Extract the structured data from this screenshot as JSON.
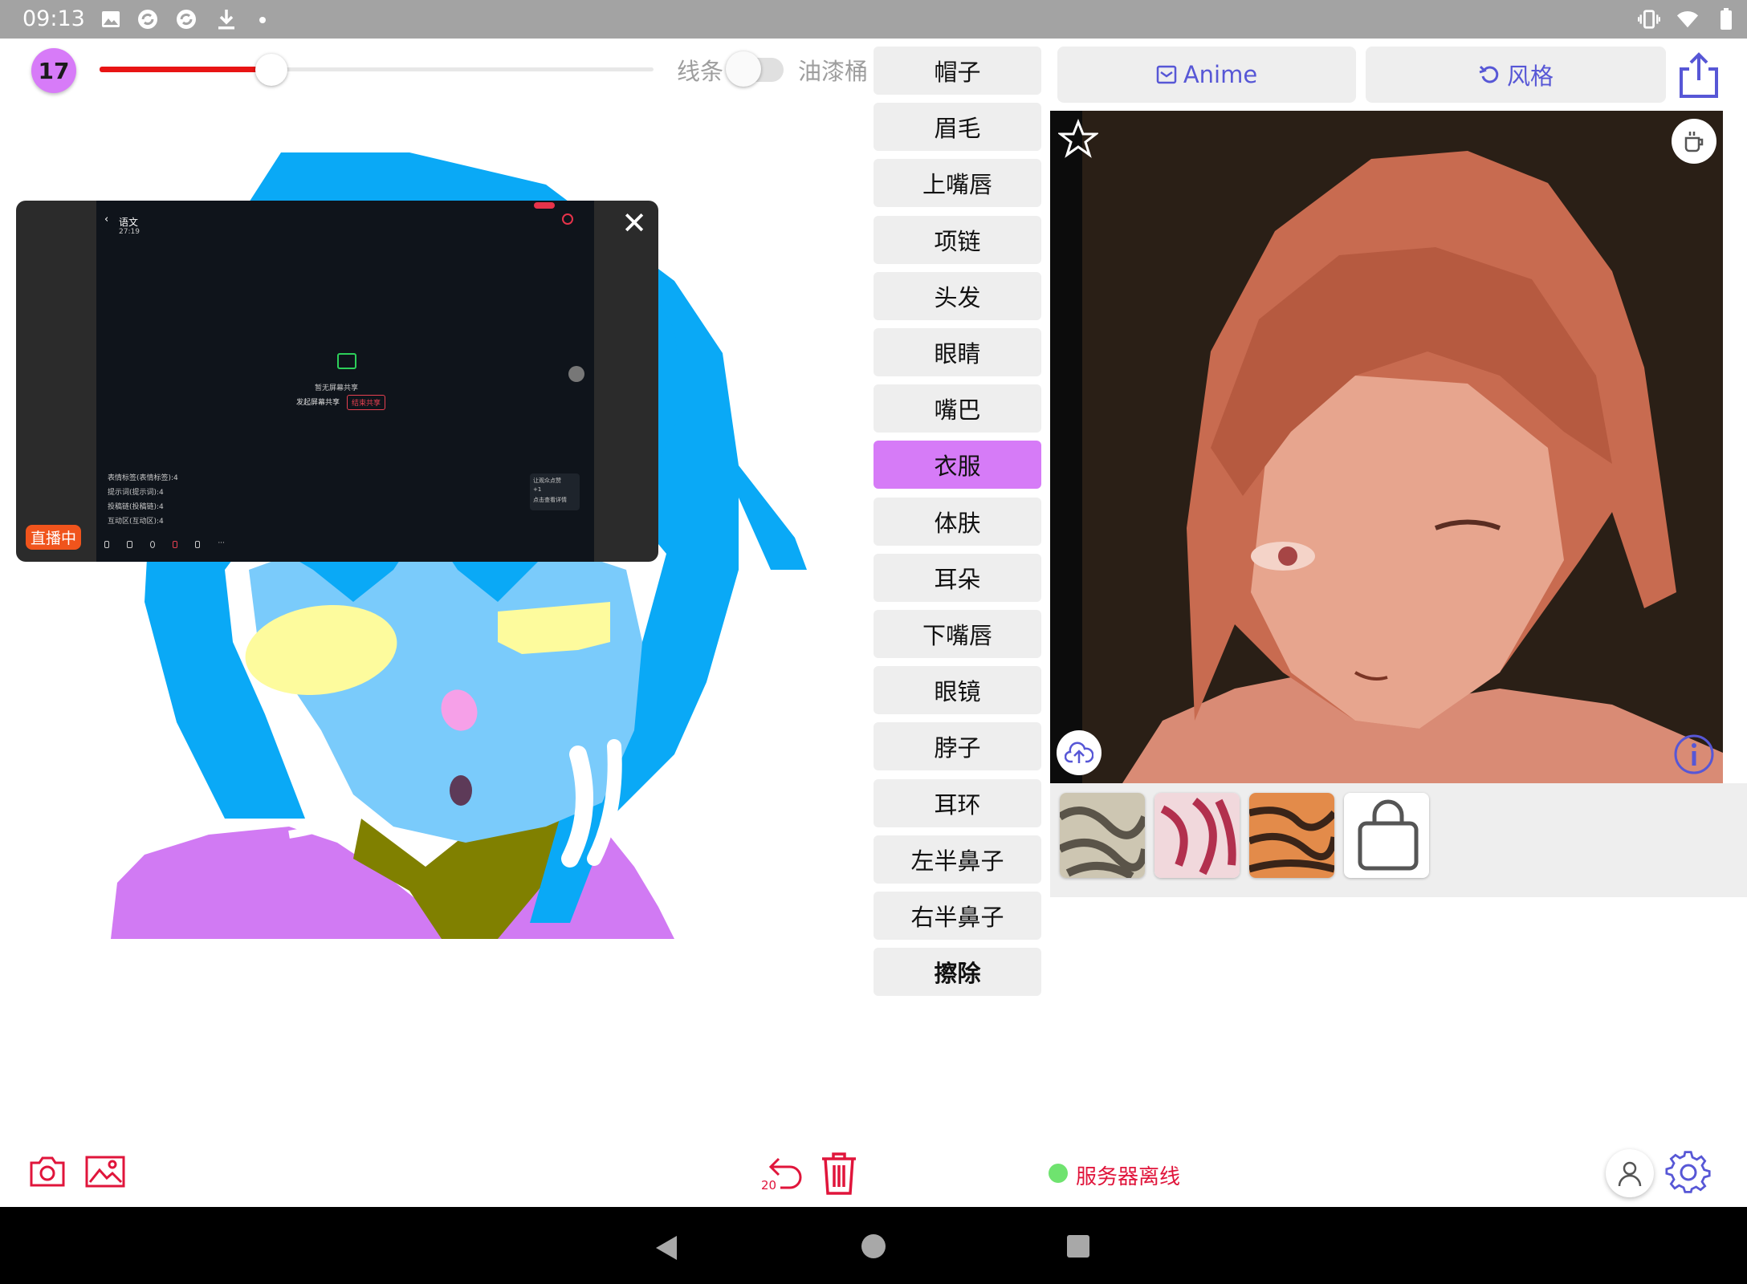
{
  "status_bar": {
    "time": "09:13",
    "icons": [
      "image-icon",
      "sync-icon",
      "sync-icon",
      "download-icon",
      "dot-icon",
      "vibrate-icon",
      "wifi-icon",
      "battery-icon"
    ]
  },
  "toolbar": {
    "brush_size": "17",
    "slider_fraction": 0.31,
    "mode_left_label": "线条",
    "mode_right_label": "油漆桶",
    "toggle_on": false
  },
  "overlay": {
    "live_badge": "直播中",
    "header_title": "语文",
    "header_sub": "27:19",
    "center_text": "暂无屏幕共享",
    "btn_left": "发起屏幕共享",
    "btn_right": "结束共享",
    "list_items": [
      "表情标签(表情标签):4",
      "提示词(提示词):4",
      "投稿链(投稿链):4",
      "互动区(互动区):4"
    ],
    "side_card_line1": "让观众点赞",
    "side_card_line2": "+1",
    "side_card_line3": "点击查看详情"
  },
  "labels": [
    {
      "text": "帽子",
      "active": false
    },
    {
      "text": "眉毛",
      "active": false
    },
    {
      "text": "上嘴唇",
      "active": false
    },
    {
      "text": "项链",
      "active": false
    },
    {
      "text": "头发",
      "active": false
    },
    {
      "text": "眼睛",
      "active": false
    },
    {
      "text": "嘴巴",
      "active": false
    },
    {
      "text": "衣服",
      "active": true
    },
    {
      "text": "体肤",
      "active": false
    },
    {
      "text": "耳朵",
      "active": false
    },
    {
      "text": "下嘴唇",
      "active": false
    },
    {
      "text": "眼镜",
      "active": false
    },
    {
      "text": "脖子",
      "active": false
    },
    {
      "text": "耳环",
      "active": false
    },
    {
      "text": "左半鼻子",
      "active": false
    },
    {
      "text": "右半鼻子",
      "active": false
    },
    {
      "text": "擦除",
      "active": false
    }
  ],
  "right_panel": {
    "anime_button": "Anime",
    "style_button": "风格"
  },
  "footer": {
    "undo_count": "20",
    "server_status": "服务器离线"
  },
  "colors": {
    "accent_purple": "#d67bf7",
    "slider_red": "#e81414",
    "button_blue": "#5757d6",
    "status_red": "#e0153b",
    "status_green": "#6fe36f"
  }
}
